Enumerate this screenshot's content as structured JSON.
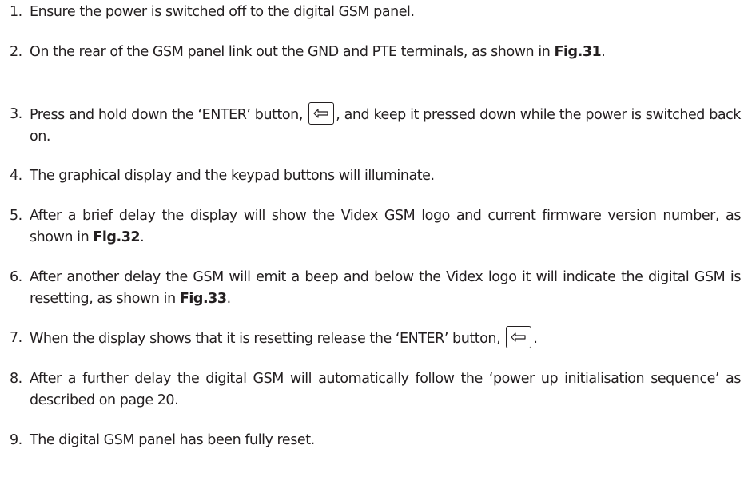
{
  "icons": {
    "enter_key": "enter-return-arrow-icon"
  },
  "steps": [
    {
      "num": "1.",
      "text": "Ensure the power is switched off to the digital GSM panel."
    },
    {
      "num": "2.",
      "text": "On the rear of the GSM panel link out the GND and PTE terminals, as shown in",
      "fig": "Fig.31",
      "after": "."
    },
    {
      "num": "3.",
      "before": "Press and hold down the ‘ENTER’ button,",
      "after": ", and keep it pressed down while the power is switched back on."
    },
    {
      "num": "4.",
      "text": "The graphical display and the keypad buttons will illuminate."
    },
    {
      "num": "5.",
      "text": "After a brief delay the display will show the Videx GSM logo and current firmware version number, as shown in",
      "fig": "Fig.32",
      "after": "."
    },
    {
      "num": "6.",
      "text": "After another delay the GSM will emit a beep and below the Videx logo it will indicate the digital GSM is resetting, as shown in",
      "fig": "Fig.33",
      "after": "."
    },
    {
      "num": "7.",
      "before": "When the display shows that it is resetting release the ‘ENTER’ button,",
      "after": "."
    },
    {
      "num": "8.",
      "text": "After a further delay the digital GSM will automatically follow the ‘power up initialisation sequence’ as described on page 20."
    },
    {
      "num": "9.",
      "text": "The digital GSM panel has been fully reset."
    }
  ]
}
